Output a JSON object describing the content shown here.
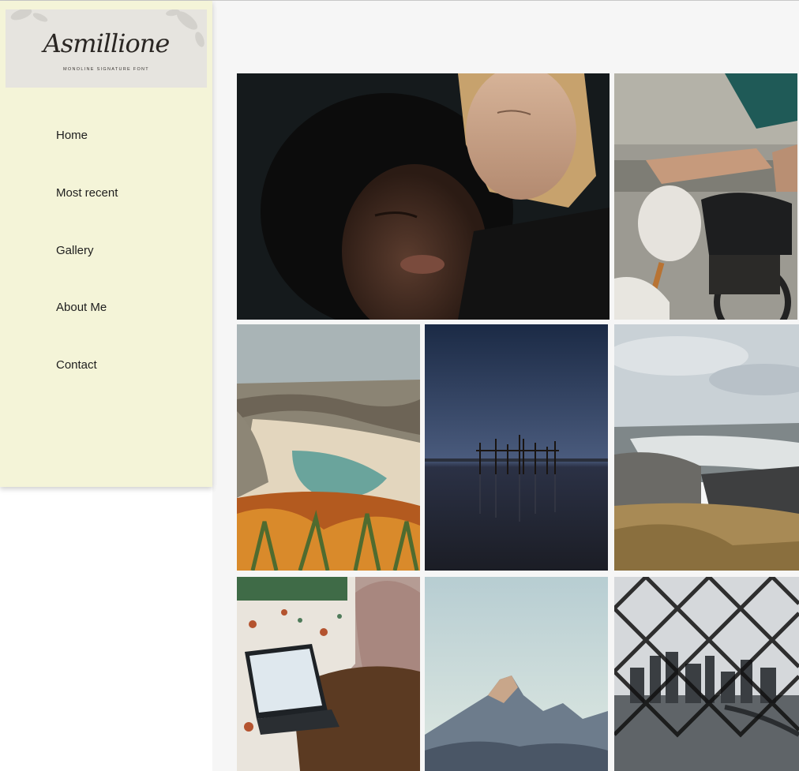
{
  "logo": {
    "wordmark": "Asmillione",
    "tagline": "MONOLINE SIGNATURE FONT"
  },
  "nav": {
    "items": [
      {
        "label": "Home"
      },
      {
        "label": "Most recent"
      },
      {
        "label": "Gallery"
      },
      {
        "label": "About Me"
      },
      {
        "label": "Contact"
      }
    ]
  },
  "colors": {
    "sidebar_bg": "#f4f4d8",
    "page_bg": "#f6f6f6",
    "text": "#1e1e1e"
  },
  "gallery": {
    "photos": [
      {
        "icon": "portrait-two-women-photo"
      },
      {
        "icon": "motorcycle-rider-photo"
      },
      {
        "icon": "beach-cove-cliffs-photo"
      },
      {
        "icon": "pier-at-dusk-photo"
      },
      {
        "icon": "waterfall-landscape-photo"
      },
      {
        "icon": "woman-with-laptop-photo"
      },
      {
        "icon": "mountain-peak-photo"
      },
      {
        "icon": "city-skyline-through-fence-photo"
      }
    ]
  }
}
